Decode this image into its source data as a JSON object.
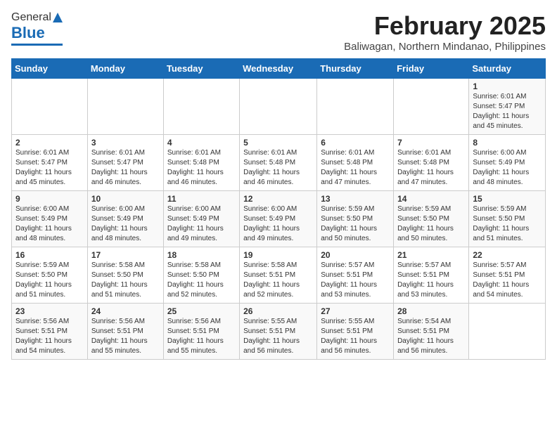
{
  "header": {
    "logo_general": "General",
    "logo_blue": "Blue",
    "title": "February 2025",
    "subtitle": "Baliwagan, Northern Mindanao, Philippines"
  },
  "days_of_week": [
    "Sunday",
    "Monday",
    "Tuesday",
    "Wednesday",
    "Thursday",
    "Friday",
    "Saturday"
  ],
  "weeks": [
    [
      {
        "day": "",
        "content": ""
      },
      {
        "day": "",
        "content": ""
      },
      {
        "day": "",
        "content": ""
      },
      {
        "day": "",
        "content": ""
      },
      {
        "day": "",
        "content": ""
      },
      {
        "day": "",
        "content": ""
      },
      {
        "day": "1",
        "content": "Sunrise: 6:01 AM\nSunset: 5:47 PM\nDaylight: 11 hours and 45 minutes."
      }
    ],
    [
      {
        "day": "2",
        "content": "Sunrise: 6:01 AM\nSunset: 5:47 PM\nDaylight: 11 hours and 45 minutes."
      },
      {
        "day": "3",
        "content": "Sunrise: 6:01 AM\nSunset: 5:47 PM\nDaylight: 11 hours and 46 minutes."
      },
      {
        "day": "4",
        "content": "Sunrise: 6:01 AM\nSunset: 5:48 PM\nDaylight: 11 hours and 46 minutes."
      },
      {
        "day": "5",
        "content": "Sunrise: 6:01 AM\nSunset: 5:48 PM\nDaylight: 11 hours and 46 minutes."
      },
      {
        "day": "6",
        "content": "Sunrise: 6:01 AM\nSunset: 5:48 PM\nDaylight: 11 hours and 47 minutes."
      },
      {
        "day": "7",
        "content": "Sunrise: 6:01 AM\nSunset: 5:48 PM\nDaylight: 11 hours and 47 minutes."
      },
      {
        "day": "8",
        "content": "Sunrise: 6:00 AM\nSunset: 5:49 PM\nDaylight: 11 hours and 48 minutes."
      }
    ],
    [
      {
        "day": "9",
        "content": "Sunrise: 6:00 AM\nSunset: 5:49 PM\nDaylight: 11 hours and 48 minutes."
      },
      {
        "day": "10",
        "content": "Sunrise: 6:00 AM\nSunset: 5:49 PM\nDaylight: 11 hours and 48 minutes."
      },
      {
        "day": "11",
        "content": "Sunrise: 6:00 AM\nSunset: 5:49 PM\nDaylight: 11 hours and 49 minutes."
      },
      {
        "day": "12",
        "content": "Sunrise: 6:00 AM\nSunset: 5:49 PM\nDaylight: 11 hours and 49 minutes."
      },
      {
        "day": "13",
        "content": "Sunrise: 5:59 AM\nSunset: 5:50 PM\nDaylight: 11 hours and 50 minutes."
      },
      {
        "day": "14",
        "content": "Sunrise: 5:59 AM\nSunset: 5:50 PM\nDaylight: 11 hours and 50 minutes."
      },
      {
        "day": "15",
        "content": "Sunrise: 5:59 AM\nSunset: 5:50 PM\nDaylight: 11 hours and 51 minutes."
      }
    ],
    [
      {
        "day": "16",
        "content": "Sunrise: 5:59 AM\nSunset: 5:50 PM\nDaylight: 11 hours and 51 minutes."
      },
      {
        "day": "17",
        "content": "Sunrise: 5:58 AM\nSunset: 5:50 PM\nDaylight: 11 hours and 51 minutes."
      },
      {
        "day": "18",
        "content": "Sunrise: 5:58 AM\nSunset: 5:50 PM\nDaylight: 11 hours and 52 minutes."
      },
      {
        "day": "19",
        "content": "Sunrise: 5:58 AM\nSunset: 5:51 PM\nDaylight: 11 hours and 52 minutes."
      },
      {
        "day": "20",
        "content": "Sunrise: 5:57 AM\nSunset: 5:51 PM\nDaylight: 11 hours and 53 minutes."
      },
      {
        "day": "21",
        "content": "Sunrise: 5:57 AM\nSunset: 5:51 PM\nDaylight: 11 hours and 53 minutes."
      },
      {
        "day": "22",
        "content": "Sunrise: 5:57 AM\nSunset: 5:51 PM\nDaylight: 11 hours and 54 minutes."
      }
    ],
    [
      {
        "day": "23",
        "content": "Sunrise: 5:56 AM\nSunset: 5:51 PM\nDaylight: 11 hours and 54 minutes."
      },
      {
        "day": "24",
        "content": "Sunrise: 5:56 AM\nSunset: 5:51 PM\nDaylight: 11 hours and 55 minutes."
      },
      {
        "day": "25",
        "content": "Sunrise: 5:56 AM\nSunset: 5:51 PM\nDaylight: 11 hours and 55 minutes."
      },
      {
        "day": "26",
        "content": "Sunrise: 5:55 AM\nSunset: 5:51 PM\nDaylight: 11 hours and 56 minutes."
      },
      {
        "day": "27",
        "content": "Sunrise: 5:55 AM\nSunset: 5:51 PM\nDaylight: 11 hours and 56 minutes."
      },
      {
        "day": "28",
        "content": "Sunrise: 5:54 AM\nSunset: 5:51 PM\nDaylight: 11 hours and 56 minutes."
      },
      {
        "day": "",
        "content": ""
      }
    ]
  ]
}
